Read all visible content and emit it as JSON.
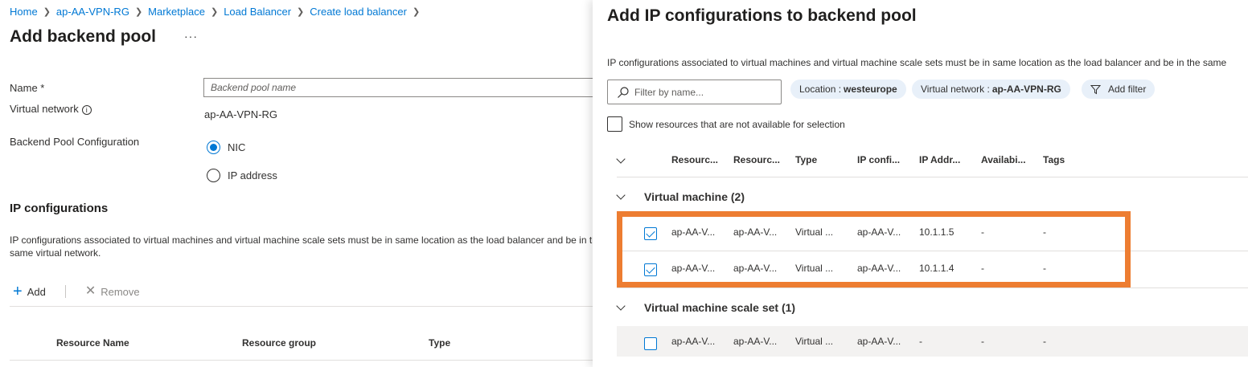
{
  "breadcrumb": [
    "Home",
    "ap-AA-VPN-RG",
    "Marketplace",
    "Load Balancer",
    "Create load balancer"
  ],
  "page": {
    "title": "Add backend pool",
    "more": "···"
  },
  "form": {
    "name_label": "Name *",
    "name_placeholder": "Backend pool name",
    "vnet_label": "Virtual network",
    "vnet_value": "ap-AA-VPN-RG",
    "config_label": "Backend Pool Configuration",
    "options": [
      {
        "label": "NIC",
        "selected": true
      },
      {
        "label": "IP address",
        "selected": false
      }
    ]
  },
  "ipconfig": {
    "title": "IP configurations",
    "description": "IP configurations associated to virtual machines and virtual machine scale sets must be in same location as the load balancer and be in the same virtual network.",
    "add_label": "Add",
    "remove_label": "Remove",
    "columns": [
      "Resource Name",
      "Resource group",
      "Type"
    ]
  },
  "panel": {
    "title": "Add IP configurations to backend pool",
    "description": "IP configurations associated to virtual machines and virtual machine scale sets must be in same location as the load balancer and be in the same",
    "filter_placeholder": "Filter by name...",
    "pills": [
      {
        "key": "Location :",
        "value": "westeurope"
      },
      {
        "key": "Virtual network :",
        "value": "ap-AA-VPN-RG"
      }
    ],
    "add_filter_label": "Add filter",
    "show_unavailable_label": "Show resources that are not available for selection",
    "columns": [
      "Resourc...",
      "Resourc...",
      "Type",
      "IP confi...",
      "IP Addr...",
      "Availabi...",
      "Tags"
    ],
    "groups": [
      {
        "title": "Virtual machine (2)",
        "rows": [
          {
            "checked": true,
            "cells": [
              "ap-AA-V...",
              "ap-AA-V...",
              "Virtual ...",
              "ap-AA-V...",
              "10.1.1.5",
              "-",
              "-"
            ]
          },
          {
            "checked": true,
            "cells": [
              "ap-AA-V...",
              "ap-AA-V...",
              "Virtual ...",
              "ap-AA-V...",
              "10.1.1.4",
              "-",
              "-"
            ]
          }
        ]
      },
      {
        "title": "Virtual machine scale set (1)",
        "rows": [
          {
            "checked": false,
            "cells": [
              "ap-AA-V...",
              "ap-AA-V...",
              "Virtual ...",
              "ap-AA-V...",
              "-",
              "-",
              "-"
            ]
          }
        ]
      }
    ]
  },
  "colors": {
    "accent": "#0078d4",
    "highlight": "#ed7d31"
  }
}
